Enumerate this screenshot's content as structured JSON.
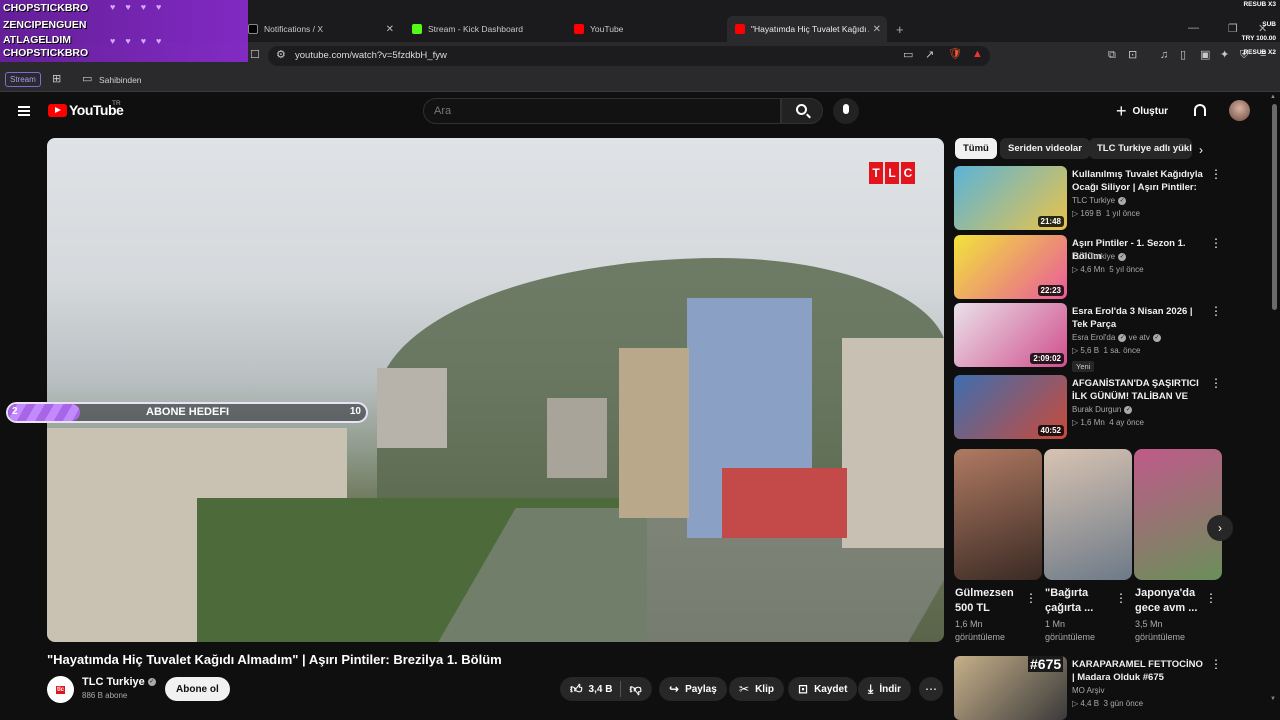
{
  "browser": {
    "tabs": [
      {
        "title": "Notifications / X",
        "icon": "x-icon"
      },
      {
        "title": "Stream - Kick Dashboard",
        "icon": "kick-icon"
      },
      {
        "title": "YouTube",
        "icon": "youtube-icon"
      },
      {
        "title": "\"Hayatımda Hiç Tuvalet Kağıdı A",
        "icon": "youtube-icon",
        "active": true
      }
    ],
    "url": "youtube.com/watch?v=5fzdkbH_fyw",
    "bookmarks": {
      "stream_chip": "Stream",
      "folder": "Sahibinden"
    },
    "extension_badges": {
      "shield_count": "6",
      "alert_count": "1"
    }
  },
  "stream_overlay": {
    "lines": [
      "CHOPSTICKBRO",
      "ZENCIPENGUEN",
      "ATLAGELDIM",
      "CHOPSTICKBRO"
    ],
    "right_labels": [
      "RESUB X3",
      "SUB",
      "TRY 100.00",
      "RESUB X2"
    ],
    "hearts": "♥♥♥♥"
  },
  "youtube": {
    "logo_text": "YouTube",
    "country": "TR",
    "search": {
      "placeholder": "Ara"
    },
    "create_label": "Oluştur"
  },
  "video": {
    "title": "\"Hayatımda Hiç Tuvalet Kağıdı Almadım\" | Aşırı Pintiler: Brezilya 1. Bölüm",
    "watermark": [
      "T",
      "L",
      "C"
    ],
    "goal": {
      "current": "2",
      "label": "ABONE HEDEFI",
      "max": "10",
      "fraction": 0.2
    },
    "channel": {
      "name": "TLC Turkiye",
      "subs": "886 B abone",
      "avatar_text": "tlc"
    },
    "subscribe_label": "Abone ol",
    "actions": {
      "likes": "3,4 B",
      "share": "Paylaş",
      "clip": "Klip",
      "save": "Kaydet",
      "download": "İndir"
    }
  },
  "sidebar": {
    "chips": [
      "Tümü",
      "Seriden videolar",
      "TLC Turkiye adlı yükle"
    ],
    "recommendations": [
      {
        "title": "Kullanılmış Tuvalet Kağıdıyla Ocağı Siliyor | Aşırı Pintiler: ...",
        "channel": "TLC Turkiye",
        "views": "169 B",
        "age": "1 yıl önce",
        "duration": "21:48",
        "thumb_colors": [
          "#5ab4d8",
          "#e9c34a"
        ]
      },
      {
        "title": "Aşırı Pintiler - 1. Sezon 1. Bölüm",
        "channel": "TLC Turkiye",
        "views": "4,6 Mn",
        "age": "5 yıl önce",
        "duration": "22:23",
        "thumb_colors": [
          "#f2e43a",
          "#e85a9a"
        ]
      },
      {
        "title": "Esra Erol'da 3 Nisan 2026 | Tek Parça",
        "channel": "Esra Erol'da",
        "channel2": "ve atv",
        "views": "5,6 B",
        "age": "1 sa. önce",
        "duration": "2:09:02",
        "badge": "Yeni",
        "thumb_colors": [
          "#e9e2ea",
          "#d14e8d"
        ]
      },
      {
        "title": "AFGANİSTAN'DA ŞAŞIRTICI İLK GÜNÜM! TALİBAN VE ŞERİAT ...",
        "channel": "Burak Durgun",
        "views": "1,6 Mn",
        "age": "4 ay önce",
        "duration": "40:52",
        "thumb_colors": [
          "#3d6fb0",
          "#c94a3a"
        ]
      },
      {
        "title": "KARAPARAMEL FETTOCİNO | Madara Olduk #675",
        "channel": "MO Arşiv",
        "views": "4,4 B",
        "age": "3 gün önce",
        "duration": "",
        "thumb_colors": [
          "#c7b08a",
          "#3a3a3a"
        ]
      }
    ],
    "shorts": [
      {
        "title": "Gülmezsen 500 TL",
        "views": "1,6 Mn görüntüleme",
        "thumb_colors": [
          "#b07a62",
          "#3a2a24"
        ]
      },
      {
        "title": "\"Bağırta çağırta ...",
        "views": "1 Mn görüntüleme",
        "thumb_colors": [
          "#d8c3b2",
          "#6d7a88"
        ]
      },
      {
        "title": "Japonya'da gece avm ...",
        "views": "3,5 Mn görüntüleme",
        "thumb_colors": [
          "#c05a8a",
          "#6a8f5a"
        ]
      }
    ],
    "karaparamel_thumb_text": "#675"
  }
}
